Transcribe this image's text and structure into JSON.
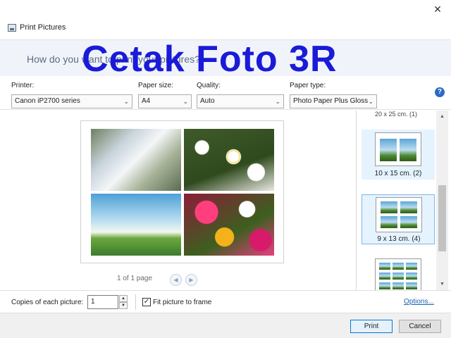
{
  "window": {
    "title": "Print Pictures",
    "close_icon": "close-icon",
    "close_glyph": "✕"
  },
  "prompt": {
    "text": "How do you want to print your pictures?"
  },
  "overlay": {
    "text": "Cetak Foto 3R",
    "color": "#1a1ad8"
  },
  "options": {
    "printer_label": "Printer:",
    "printer_value": "Canon iP2700 series",
    "paper_size_label": "Paper size:",
    "paper_size_value": "A4",
    "quality_label": "Quality:",
    "quality_value": "Auto",
    "paper_type_label": "Paper type:",
    "paper_type_value": "Photo Paper Plus Gloss",
    "help_glyph": "?"
  },
  "preview": {
    "photos": [
      "white-blossoms",
      "white-daisies",
      "daisy-field-sky",
      "colorful-flowers"
    ],
    "page_indicator": "1 of 1 page",
    "prev_glyph": "◀",
    "next_glyph": "▶"
  },
  "layouts": {
    "items": [
      {
        "label": "20 x 25 cm. (1)",
        "state": "cut-off"
      },
      {
        "label": "10 x 15 cm. (2)",
        "state": "hover"
      },
      {
        "label": "9 x 13 cm. (4)",
        "state": "selected"
      },
      {
        "label": "",
        "state": "partial"
      }
    ],
    "scroll_up_glyph": "▲",
    "scroll_down_glyph": "▼"
  },
  "copies": {
    "label": "Copies of each picture:",
    "value": "1",
    "spin_up_glyph": "▲",
    "spin_down_glyph": "▼"
  },
  "fit": {
    "label": "Fit picture to frame",
    "checked": true,
    "check_glyph": "✓"
  },
  "links": {
    "options": "Options..."
  },
  "buttons": {
    "print": "Print",
    "cancel": "Cancel"
  },
  "colors": {
    "accent": "#0078d7",
    "link": "#1a5fb4",
    "selection": "#e5f3ff"
  }
}
